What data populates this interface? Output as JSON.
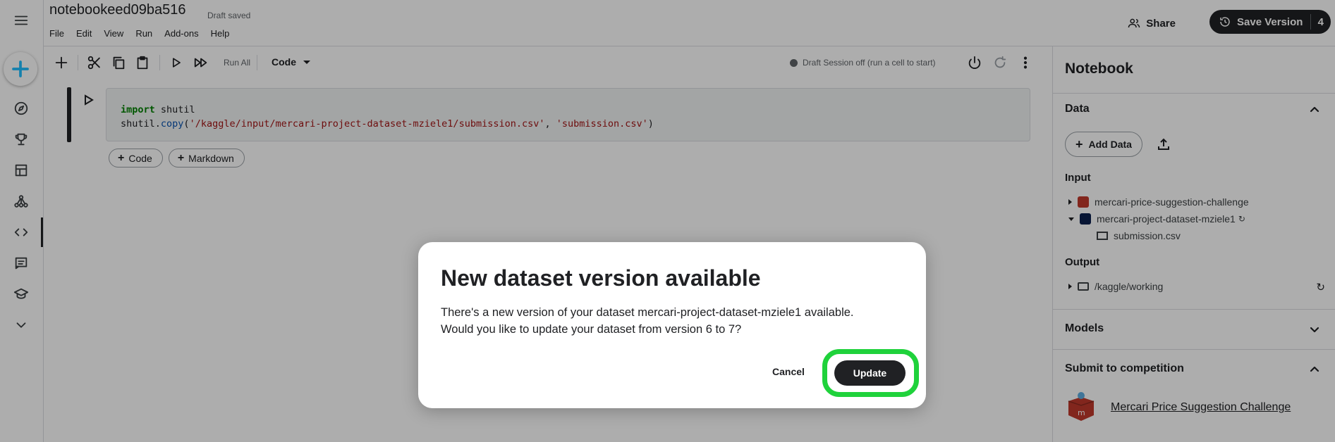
{
  "header": {
    "title": "notebookeed09ba516",
    "status": "Draft saved",
    "menu": [
      "File",
      "Edit",
      "View",
      "Run",
      "Add-ons",
      "Help"
    ],
    "share_label": "Share",
    "save_version_label": "Save Version",
    "save_version_count": "4"
  },
  "toolbar": {
    "run_all_label": "Run All",
    "cell_type": "Code",
    "session_status": "Draft Session off (run a cell to start)"
  },
  "cell": {
    "line1_kw": "import",
    "line1_rest": " shutil",
    "line2_obj": "shutil.",
    "line2_fn": "copy",
    "line2_open": "(",
    "line2_arg1": "'/kaggle/input/mercari-project-dataset-mziele1/submission.csv'",
    "line2_sep": ", ",
    "line2_arg2": "'submission.csv'",
    "line2_close": ")"
  },
  "add_cell": {
    "code_label": "Code",
    "markdown_label": "Markdown"
  },
  "panel": {
    "title": "Notebook",
    "data_section": "Data",
    "add_data_label": "Add Data",
    "input_label": "Input",
    "inputs": [
      "mercari-price-suggestion-challenge",
      "mercari-project-dataset-mziele1"
    ],
    "input_file": "submission.csv",
    "output_label": "Output",
    "output_path": "/kaggle/working",
    "models_section": "Models",
    "submit_section": "Submit to competition",
    "competition_name": "Mercari Price Suggestion Challenge"
  },
  "dialog": {
    "title": "New dataset version available",
    "body_line1": "There's a new version of your dataset mercari-project-dataset-mziele1 available.",
    "body_line2": "Would you like to update your dataset from version 6 to 7?",
    "cancel_label": "Cancel",
    "update_label": "Update"
  },
  "colors": {
    "accent_blue": "#20beff",
    "highlight_green": "#1fd23b",
    "dark": "#202124"
  }
}
